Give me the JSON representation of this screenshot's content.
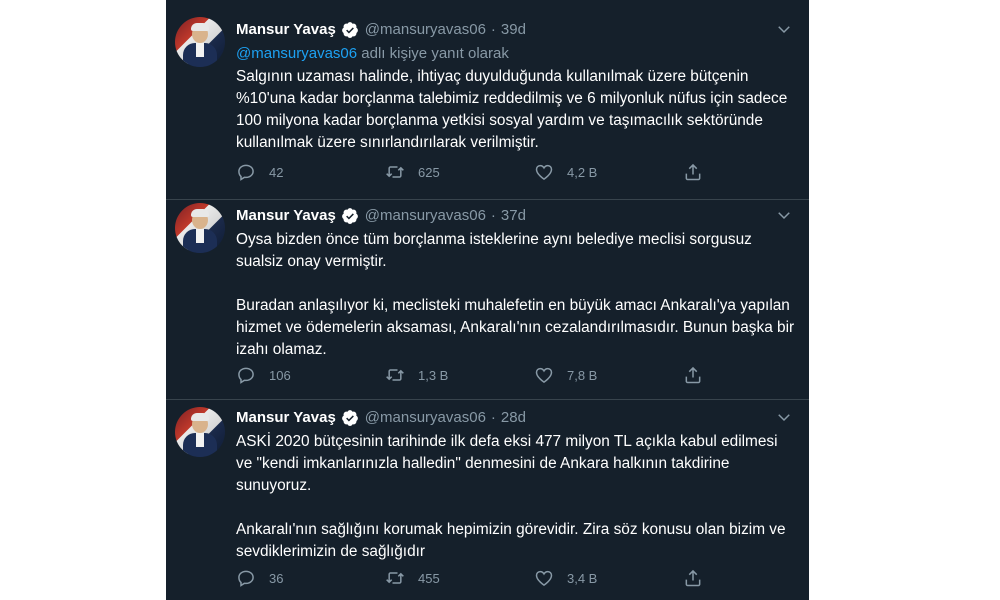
{
  "tweets": [
    {
      "name": "Mansur Yavaş",
      "handle": "@mansuryavas06",
      "separator": "·",
      "time": "39d",
      "reply_mention": "@mansuryavas06",
      "reply_suffix": " adlı kişiye yanıt olarak",
      "text": "Salgının uzaması halinde, ihtiyaç duyulduğunda kullanılmak üzere bütçenin %10'una kadar borçlanma talebimiz reddedilmiş ve 6 milyonluk nüfus için sadece 100 milyona kadar borçlanma yetkisi sosyal yardım ve taşımacılık sektöründe kullanılmak üzere sınırlandırılarak verilmiştir.",
      "replies": "42",
      "retweets": "625",
      "likes": "4,2 B"
    },
    {
      "name": "Mansur Yavaş",
      "handle": "@mansuryavas06",
      "separator": "·",
      "time": "37d",
      "text": "Oysa bizden önce tüm borçlanma isteklerine aynı belediye meclisi sorgusuz sualsiz onay vermiştir.\n\nBuradan anlaşılıyor ki, meclisteki muhalefetin en büyük amacı Ankaralı'ya yapılan hizmet ve ödemelerin aksaması, Ankaralı'nın cezalandırılmasıdır. Bunun başka bir izahı olamaz.",
      "replies": "106",
      "retweets": "1,3 B",
      "likes": "7,8 B"
    },
    {
      "name": "Mansur Yavaş",
      "handle": "@mansuryavas06",
      "separator": "·",
      "time": "28d",
      "text": "ASKİ 2020 bütçesinin tarihinde ilk defa eksi 477 milyon TL açıkla kabul edilmesi ve \"kendi imkanlarınızla halledin\" denmesini de Ankara halkının takdirine sunuyoruz.\n\nAnkaralı'nın sağlığını korumak hepimizin görevidir. Zira söz konusu olan bizim ve sevdiklerimizin de sağlığıdır",
      "replies": "36",
      "retweets": "455",
      "likes": "3,4 B"
    }
  ],
  "colors": {
    "background": "#15202b",
    "text": "#ffffff",
    "secondary": "#8899a6",
    "accent": "#1da1f2",
    "divider": "#38444d"
  },
  "icons": [
    "verified-icon",
    "chevron-down-icon",
    "reply-icon",
    "retweet-icon",
    "like-icon",
    "share-icon"
  ]
}
